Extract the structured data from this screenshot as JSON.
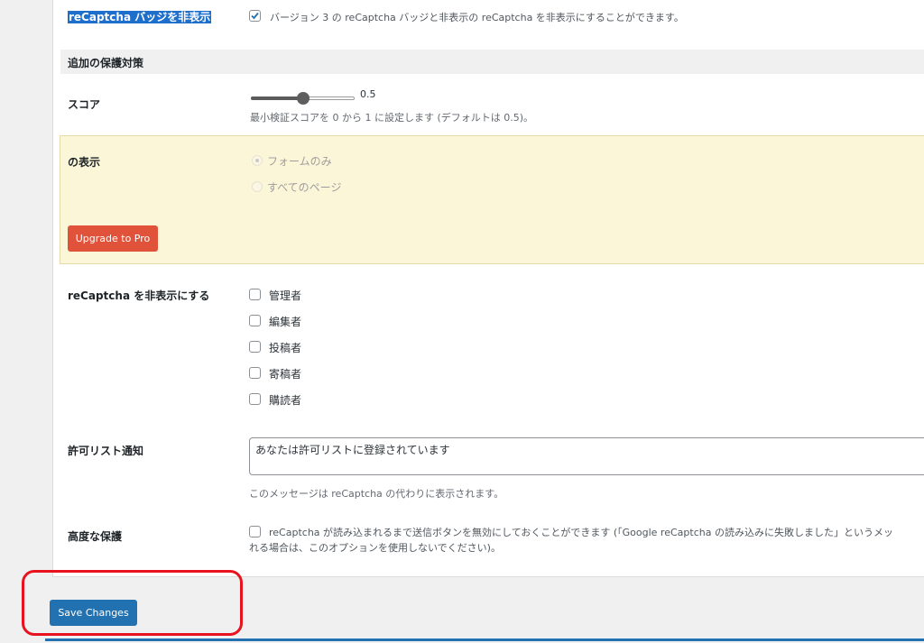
{
  "badge": {
    "label": "reCaptcha バッジを非表示",
    "description": "バージョン 3 の reCaptcha バッジと非表示の reCaptcha を非表示にすることができます。",
    "checked": true
  },
  "section": {
    "title": "追加の保護対策"
  },
  "score": {
    "label": "スコア",
    "value": "0.5",
    "fraction": 0.5,
    "description": "最小検証スコアを 0 から 1 に設定します (デフォルトは 0.5)。"
  },
  "display": {
    "label": "の表示",
    "options": [
      "フォームのみ",
      "すべてのページ"
    ],
    "selected": "フォームのみ",
    "upgrade_label": "Upgrade to Pro"
  },
  "hide_recaptcha": {
    "label": "reCaptcha を非表示にする",
    "roles": [
      "管理者",
      "編集者",
      "投稿者",
      "寄稿者",
      "購読者"
    ]
  },
  "allowlist": {
    "label": "許可リスト通知",
    "value": "あなたは許可リストに登録されています",
    "description": "このメッセージは reCaptcha の代わりに表示されます。"
  },
  "advanced": {
    "label": "高度な保護",
    "description_line1": "reCaptcha が読み込まれるまで送信ボタンを無効にしておくことができます (「Google reCaptcha の読み込みに失敗しました」というメッ",
    "description_line2": "れる場合は、このオプションを使用しないでください)。"
  },
  "save_label": "Save Changes",
  "colors": {
    "primary": "#2271b1",
    "upgrade": "#e0533a",
    "pro_box_bg": "#fcf6d9",
    "annotation": "#e8131e"
  }
}
